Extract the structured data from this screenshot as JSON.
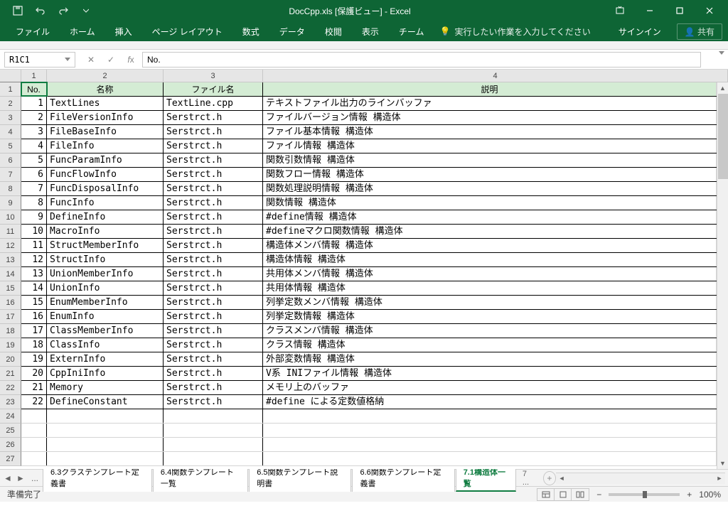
{
  "titleBar": {
    "title": "DocCpp.xls [保護ビュー] - Excel"
  },
  "ribbonTabs": [
    "ファイル",
    "ホーム",
    "挿入",
    "ページ レイアウト",
    "数式",
    "データ",
    "校閲",
    "表示",
    "チーム"
  ],
  "tellMe": "実行したい作業を入力してください",
  "signIn": "サインイン",
  "share": "共有",
  "nameBox": "R1C1",
  "formulaValue": "No.",
  "colHeaders": [
    "1",
    "2",
    "3",
    "4"
  ],
  "headerRow": {
    "c1": "No.",
    "c2": "名称",
    "c3": "ファイル名",
    "c4": "説明"
  },
  "rows": [
    {
      "no": "1",
      "name": "TextLines",
      "file": "TextLine.cpp",
      "desc": "テキストファイル出力のラインバッファ"
    },
    {
      "no": "2",
      "name": "FileVersionInfo",
      "file": "Serstrct.h",
      "desc": "ファイルバージョン情報 構造体"
    },
    {
      "no": "3",
      "name": "FileBaseInfo",
      "file": "Serstrct.h",
      "desc": "ファイル基本情報 構造体"
    },
    {
      "no": "4",
      "name": "FileInfo",
      "file": "Serstrct.h",
      "desc": "ファイル情報 構造体"
    },
    {
      "no": "5",
      "name": "FuncParamInfo",
      "file": "Serstrct.h",
      "desc": "関数引数情報 構造体"
    },
    {
      "no": "6",
      "name": "FuncFlowInfo",
      "file": "Serstrct.h",
      "desc": "関数フロー情報 構造体"
    },
    {
      "no": "7",
      "name": "FuncDisposalInfo",
      "file": "Serstrct.h",
      "desc": "関数処理説明情報 構造体"
    },
    {
      "no": "8",
      "name": "FuncInfo",
      "file": "Serstrct.h",
      "desc": "関数情報 構造体"
    },
    {
      "no": "9",
      "name": "DefineInfo",
      "file": "Serstrct.h",
      "desc": "#define情報 構造体"
    },
    {
      "no": "10",
      "name": "MacroInfo",
      "file": "Serstrct.h",
      "desc": "#defineマクロ関数情報 構造体"
    },
    {
      "no": "11",
      "name": "StructMemberInfo",
      "file": "Serstrct.h",
      "desc": "構造体メンバ情報 構造体"
    },
    {
      "no": "12",
      "name": "StructInfo",
      "file": "Serstrct.h",
      "desc": "構造体情報 構造体"
    },
    {
      "no": "13",
      "name": "UnionMemberInfo",
      "file": "Serstrct.h",
      "desc": "共用体メンバ情報 構造体"
    },
    {
      "no": "14",
      "name": "UnionInfo",
      "file": "Serstrct.h",
      "desc": "共用体情報 構造体"
    },
    {
      "no": "15",
      "name": "EnumMemberInfo",
      "file": "Serstrct.h",
      "desc": "列挙定数メンバ情報 構造体"
    },
    {
      "no": "16",
      "name": "EnumInfo",
      "file": "Serstrct.h",
      "desc": "列挙定数情報 構造体"
    },
    {
      "no": "17",
      "name": "ClassMemberInfo",
      "file": "Serstrct.h",
      "desc": "クラスメンバ情報 構造体"
    },
    {
      "no": "18",
      "name": "ClassInfo",
      "file": "Serstrct.h",
      "desc": "クラス情報 構造体"
    },
    {
      "no": "19",
      "name": "ExternInfo",
      "file": "Serstrct.h",
      "desc": "外部変数情報 構造体"
    },
    {
      "no": "20",
      "name": "CppIniInfo",
      "file": "Serstrct.h",
      "desc": "V系 INIファイル情報 構造体"
    },
    {
      "no": "21",
      "name": "Memory",
      "file": "Serstrct.h",
      "desc": "メモリ上のバッファ"
    },
    {
      "no": "22",
      "name": "DefineConstant",
      "file": "Serstrct.h",
      "desc": "#define による定数値格納"
    }
  ],
  "emptyRows": 4,
  "sheetTabs": [
    {
      "label": "6.3クラステンプレート定義書",
      "active": false
    },
    {
      "label": "6.4関数テンプレート一覧",
      "active": false
    },
    {
      "label": "6.5関数テンプレート説明書",
      "active": false
    },
    {
      "label": "6.6関数テンプレート定義書",
      "active": false
    },
    {
      "label": "7.1構造体一覧",
      "active": true
    }
  ],
  "sheetMore": "...",
  "sheetMoreRight": "7 ...",
  "status": {
    "ready": "準備完了",
    "zoom": "100%",
    "minus": "−",
    "plus": "+"
  }
}
